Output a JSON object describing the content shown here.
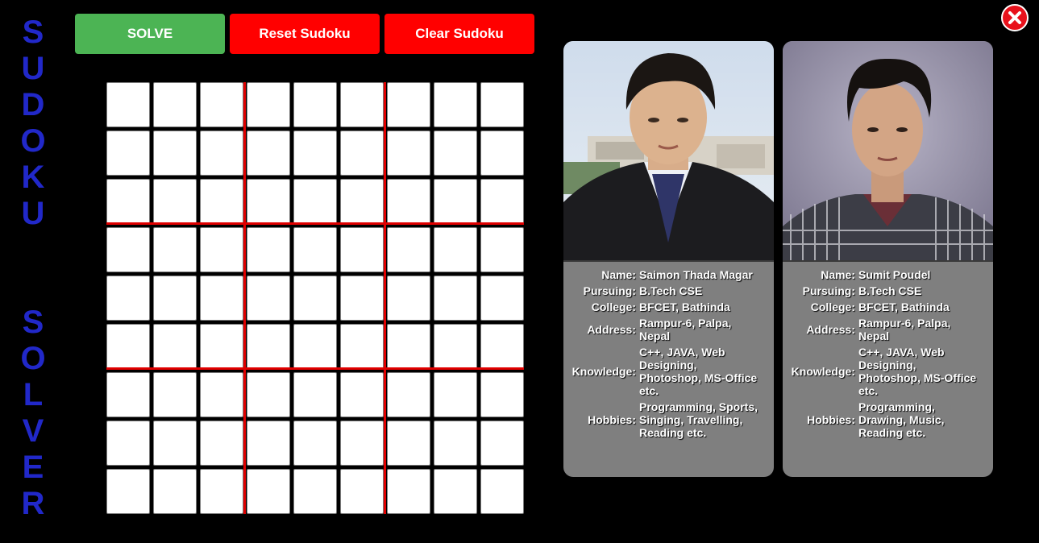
{
  "title": {
    "word1": [
      "S",
      "U",
      "D",
      "O",
      "K",
      "U"
    ],
    "word2": [
      "S",
      "O",
      "L",
      "V",
      "E",
      "R"
    ]
  },
  "toolbar": {
    "solve_label": "SOLVE",
    "reset_label": "Reset Sudoku",
    "clear_label": "Clear Sudoku",
    "close_icon": "close-icon"
  },
  "colors": {
    "title": "#2128c9",
    "solve_button": "#4cb454",
    "danger_button": "#ff0000",
    "grid_separator": "#e00000",
    "card_bg": "#7f7f7f"
  },
  "sudoku": {
    "cells": [
      [
        "",
        "",
        "",
        "",
        "",
        "",
        "",
        "",
        ""
      ],
      [
        "",
        "",
        "",
        "",
        "",
        "",
        "",
        "",
        ""
      ],
      [
        "",
        "",
        "",
        "",
        "",
        "",
        "",
        "",
        ""
      ],
      [
        "",
        "",
        "",
        "",
        "",
        "",
        "",
        "",
        ""
      ],
      [
        "",
        "",
        "",
        "",
        "",
        "",
        "",
        "",
        ""
      ],
      [
        "",
        "",
        "",
        "",
        "",
        "",
        "",
        "",
        ""
      ],
      [
        "",
        "",
        "",
        "",
        "",
        "",
        "",
        "",
        ""
      ],
      [
        "",
        "",
        "",
        "",
        "",
        "",
        "",
        "",
        ""
      ],
      [
        "",
        "",
        "",
        "",
        "",
        "",
        "",
        "",
        ""
      ]
    ]
  },
  "labels": {
    "name": "Name:",
    "pursuing": "Pursuing:",
    "college": "College:",
    "address": "Address:",
    "knowledge": "Knowledge:",
    "hobbies": "Hobbies:"
  },
  "profiles": [
    {
      "name": "Saimon Thada Magar",
      "pursuing": "B.Tech CSE",
      "college": "BFCET, Bathinda",
      "address": "Rampur-6, Palpa, Nepal",
      "knowledge": "C++, JAVA, Web Designing, Photoshop, MS-Office etc.",
      "hobbies": "Programming, Sports, Singing, Travelling, Reading etc."
    },
    {
      "name": "Sumit Poudel",
      "pursuing": "B.Tech CSE",
      "college": "BFCET, Bathinda",
      "address": "Rampur-6, Palpa, Nepal",
      "knowledge": "C++, JAVA, Web Designing, Photoshop, MS-Office etc.",
      "hobbies": "Programming, Drawing, Music, Reading etc."
    }
  ]
}
